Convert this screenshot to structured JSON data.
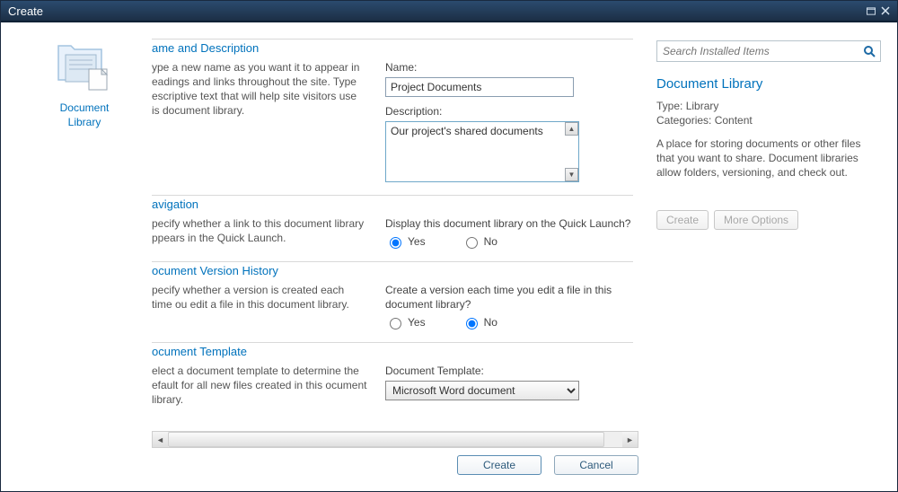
{
  "window": {
    "title": "Create"
  },
  "left": {
    "label_line1": "Document",
    "label_line2": "Library"
  },
  "sections": {
    "name": {
      "title": "ame and Description",
      "desc": "ype a new name as you want it to appear in eadings and links throughout the site. Type escriptive text that will help site visitors use is document library.",
      "name_label": "Name:",
      "name_value": "Project Documents",
      "desc_label": "Description:",
      "desc_value": "Our project's shared documents"
    },
    "nav": {
      "title": "avigation",
      "desc": "pecify whether a link to this document library ppears in the Quick Launch.",
      "question": "Display this document library on the Quick Launch?",
      "yes": "Yes",
      "no": "No",
      "selected": "yes"
    },
    "version": {
      "title": "ocument Version History",
      "desc": "pecify whether a version is created each time ou edit a file in this document library.",
      "question": "Create a version each time you edit a file in this document library?",
      "yes": "Yes",
      "no": "No",
      "selected": "no"
    },
    "template": {
      "title": "ocument Template",
      "desc": "elect a document template to determine the efault for all new files created in this ocument library.",
      "label": "Document Template:",
      "value": "Microsoft Word document"
    }
  },
  "actions": {
    "create": "Create",
    "cancel": "Cancel"
  },
  "right": {
    "search_placeholder": "Search Installed Items",
    "title": "Document Library",
    "type_label": "Type: ",
    "type_value": "Library",
    "cat_label": "Categories: ",
    "cat_value": "Content",
    "desc": "A place for storing documents or other files that you want to share. Document libraries allow folders, versioning, and check out.",
    "create": "Create",
    "more": "More Options"
  }
}
